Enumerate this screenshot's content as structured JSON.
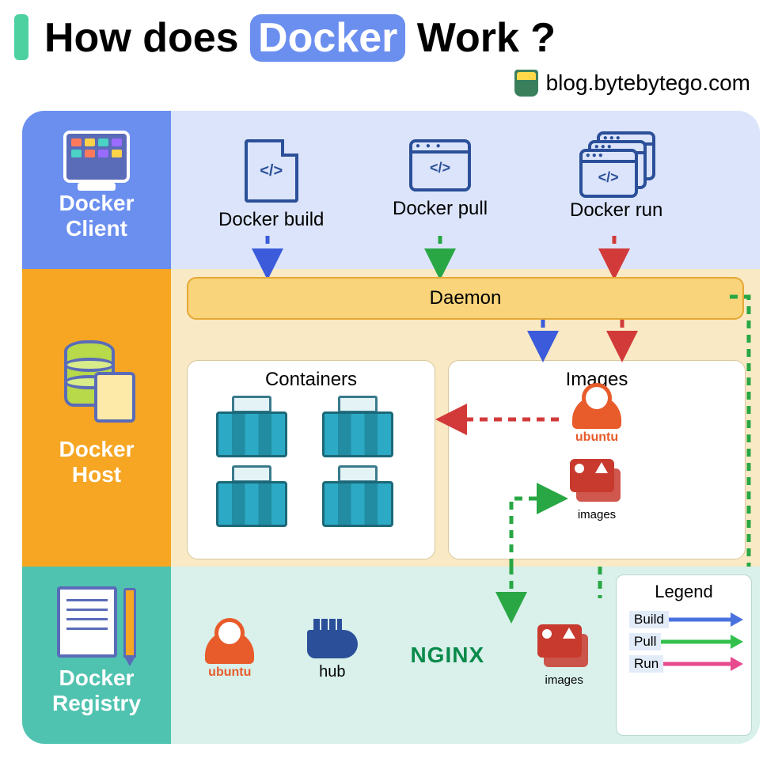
{
  "title": {
    "pre": "How does",
    "highlight": "Docker",
    "post": "Work ?"
  },
  "attribution": "blog.bytebytego.com",
  "sections": {
    "client": "Docker\nClient",
    "host": "Docker\nHost",
    "registry": "Docker\nRegistry"
  },
  "commands": {
    "build": "Docker build",
    "pull": "Docker pull",
    "run": "Docker run"
  },
  "host": {
    "daemon": "Daemon",
    "containers": "Containers",
    "images": "Images",
    "images_small": "images"
  },
  "registry": {
    "ubuntu": "ubuntu",
    "hub": "hub",
    "nginx": "NGINX",
    "images": "images"
  },
  "legend": {
    "title": "Legend",
    "build": "Build",
    "pull": "Pull",
    "run": "Run"
  },
  "colors": {
    "build": "#3b5bdb",
    "pull": "#29a745",
    "run": "#d23a3a",
    "legBuild": "#4a72df",
    "legPull": "#33c14e",
    "legRun": "#e84a8f"
  }
}
